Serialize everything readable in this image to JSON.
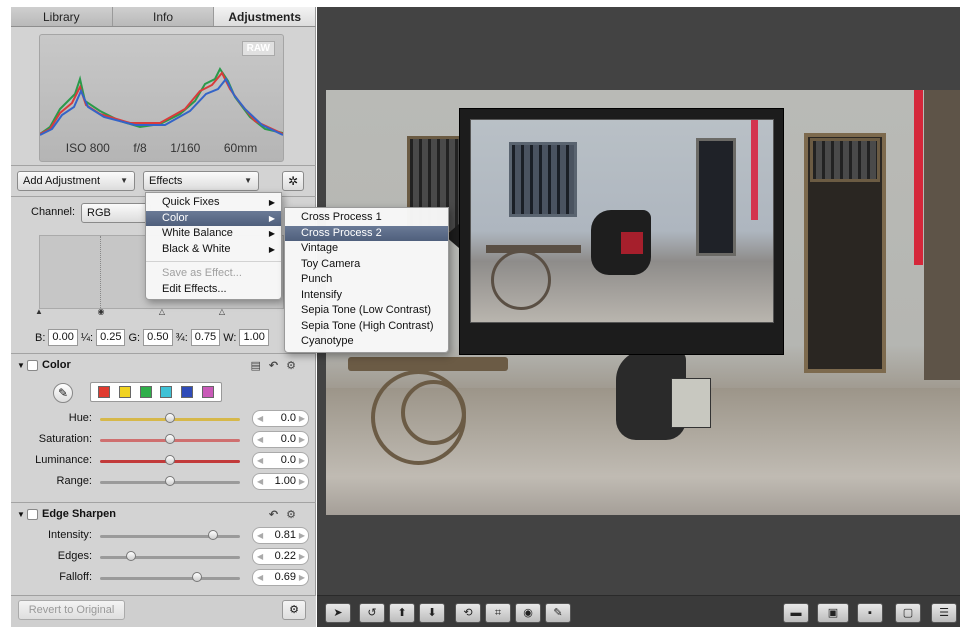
{
  "tabs": [
    {
      "label": "Library"
    },
    {
      "label": "Info"
    },
    {
      "label": "Adjustments",
      "active": true
    }
  ],
  "histogram": {
    "badge": "RAW",
    "exif": [
      "ISO 800",
      "f/8",
      "1/160",
      "60mm"
    ]
  },
  "adjust_bar": {
    "add_adjustment": "Add Adjustment",
    "effects": "Effects"
  },
  "levels": {
    "channel_label": "Channel:",
    "channel_value": "RGB",
    "fields": [
      {
        "label": "B:",
        "value": "0.00"
      },
      {
        "label": "¼:",
        "value": "0.25"
      },
      {
        "label": "G:",
        "value": "0.50"
      },
      {
        "label": "¾:",
        "value": "0.75"
      },
      {
        "label": "W:",
        "value": "1.00"
      }
    ]
  },
  "color_section": {
    "title": "Color",
    "swatches": [
      "#e03b30",
      "#f1d321",
      "#2fae4a",
      "#3fc2d6",
      "#2f4bb8",
      "#c95ab8"
    ],
    "sliders": [
      {
        "label": "Hue:",
        "value": "0.0",
        "pos": 0.5,
        "track": "#d6b84a"
      },
      {
        "label": "Saturation:",
        "value": "0.0",
        "pos": 0.5,
        "track": "#cf6f6f"
      },
      {
        "label": "Luminance:",
        "value": "0.0",
        "pos": 0.5,
        "track": "#c23a3a"
      },
      {
        "label": "Range:",
        "value": "1.00",
        "pos": 0.5,
        "track": "#9a9a9a"
      }
    ]
  },
  "edge_section": {
    "title": "Edge Sharpen",
    "sliders": [
      {
        "label": "Intensity:",
        "value": "0.81",
        "pos": 0.81,
        "track": "#9a9a9a"
      },
      {
        "label": "Edges:",
        "value": "0.22",
        "pos": 0.22,
        "track": "#9a9a9a"
      },
      {
        "label": "Falloff:",
        "value": "0.69",
        "pos": 0.69,
        "track": "#9a9a9a"
      }
    ]
  },
  "revert_label": "Revert to Original",
  "effects_menu": {
    "items": [
      {
        "label": "Quick Fixes",
        "sub": true
      },
      {
        "label": "Color",
        "sub": true,
        "selected": true
      },
      {
        "label": "White Balance",
        "sub": true
      },
      {
        "label": "Black & White",
        "sub": true
      },
      {
        "sep": true
      },
      {
        "label": "Save as Effect...",
        "disabled": true
      },
      {
        "label": "Edit Effects..."
      }
    ]
  },
  "color_submenu": {
    "items": [
      {
        "label": "Cross Process 1"
      },
      {
        "label": "Cross Process 2",
        "selected": true
      },
      {
        "label": "Vintage"
      },
      {
        "label": "Toy Camera"
      },
      {
        "label": "Punch"
      },
      {
        "label": "Intensify"
      },
      {
        "label": "Sepia Tone (Low Contrast)"
      },
      {
        "label": "Sepia Tone (High Contrast)"
      },
      {
        "label": "Cyanotype"
      }
    ]
  },
  "toolbar_icons": [
    "pointer-icon",
    "rotate-icon",
    "lift-icon",
    "stamp-icon",
    "straighten-icon",
    "crop-icon",
    "redeye-icon",
    "brush-icon"
  ],
  "toolbar_right_icons": [
    "viewer-mode-icon",
    "compare-icon",
    "inspector-icon",
    "fullscreen-icon",
    "filmstrip-icon"
  ]
}
